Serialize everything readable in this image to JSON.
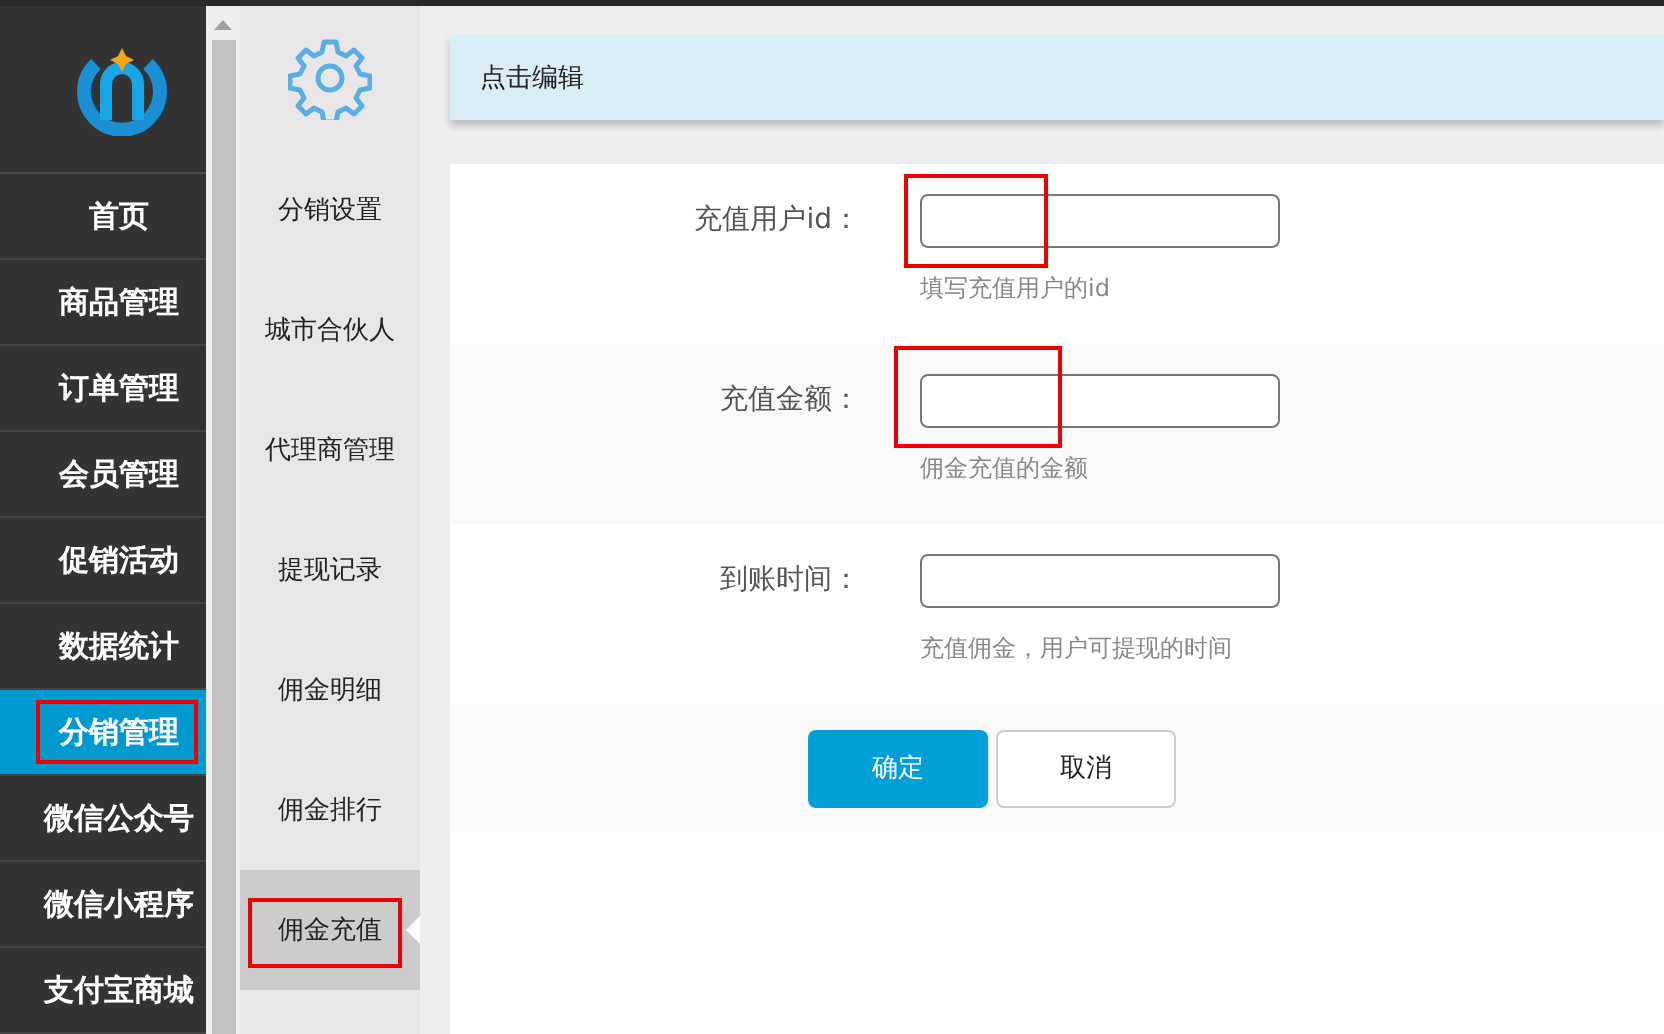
{
  "sidebar": {
    "items": [
      {
        "label": "首页",
        "selected": false,
        "highlighted": false
      },
      {
        "label": "商品管理",
        "selected": false,
        "highlighted": false
      },
      {
        "label": "订单管理",
        "selected": false,
        "highlighted": false
      },
      {
        "label": "会员管理",
        "selected": false,
        "highlighted": false
      },
      {
        "label": "促销活动",
        "selected": false,
        "highlighted": false
      },
      {
        "label": "数据统计",
        "selected": false,
        "highlighted": false
      },
      {
        "label": "分销管理",
        "selected": true,
        "highlighted": true
      },
      {
        "label": "微信公众号",
        "selected": false,
        "highlighted": false
      },
      {
        "label": "微信小程序",
        "selected": false,
        "highlighted": false
      },
      {
        "label": "支付宝商城",
        "selected": false,
        "highlighted": false
      }
    ]
  },
  "submenu": {
    "items": [
      {
        "label": "分销设置",
        "selected": false,
        "highlighted": false
      },
      {
        "label": "城市合伙人",
        "selected": false,
        "highlighted": false
      },
      {
        "label": "代理商管理",
        "selected": false,
        "highlighted": false
      },
      {
        "label": "提现记录",
        "selected": false,
        "highlighted": false
      },
      {
        "label": "佣金明细",
        "selected": false,
        "highlighted": false
      },
      {
        "label": "佣金排行",
        "selected": false,
        "highlighted": false
      },
      {
        "label": "佣金充值",
        "selected": true,
        "highlighted": true
      }
    ]
  },
  "header": {
    "title": "点击编辑"
  },
  "form": {
    "fields": [
      {
        "label": "充值用户id：",
        "hint": "填写充值用户的id",
        "highlighted": true
      },
      {
        "label": "充值金额：",
        "hint": "佣金充值的金额",
        "highlighted": true
      },
      {
        "label": "到账时间：",
        "hint": "充值佣金，用户可提现的时间",
        "highlighted": false
      }
    ],
    "buttons": [
      {
        "label": "确定",
        "kind": "primary"
      },
      {
        "label": "取消",
        "kind": "default"
      }
    ]
  }
}
